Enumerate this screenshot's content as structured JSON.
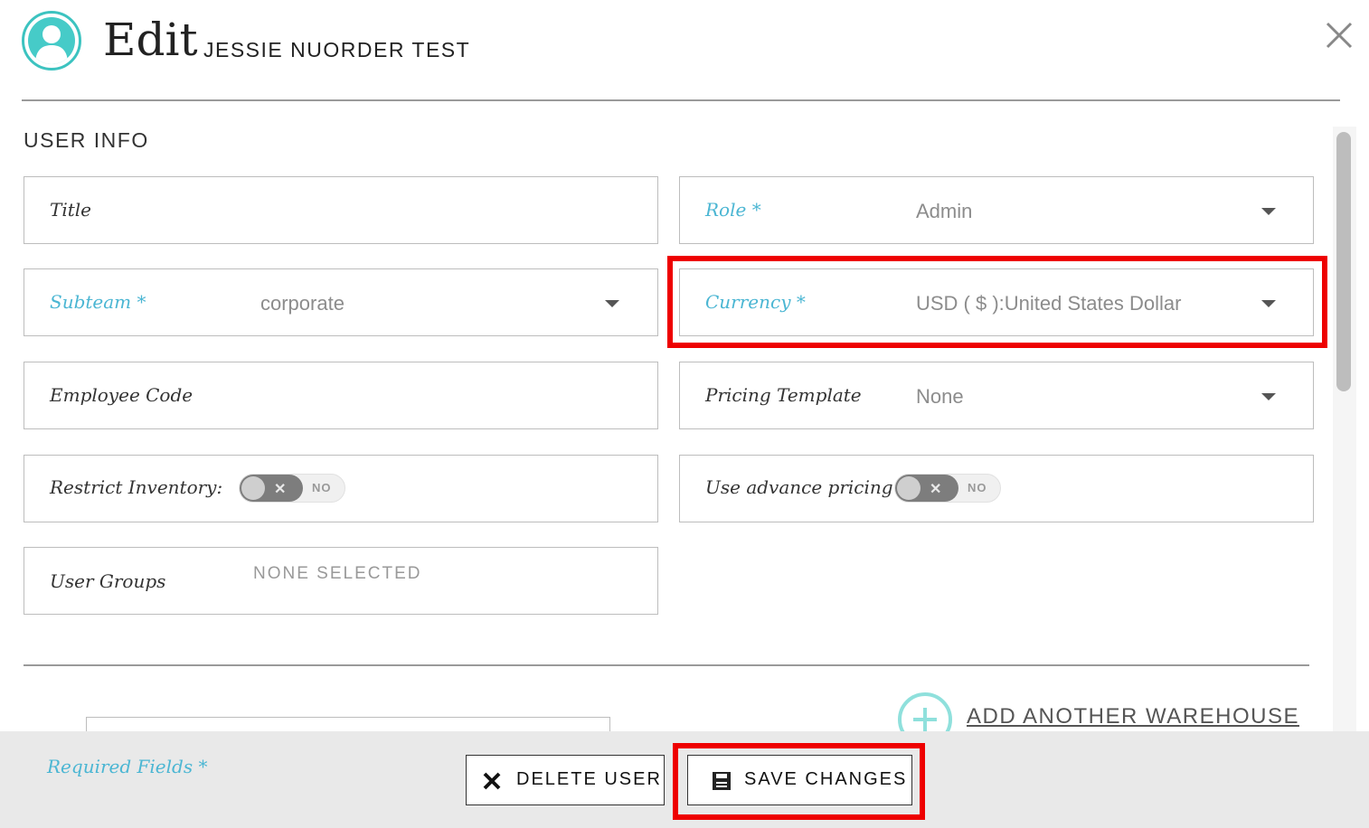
{
  "header": {
    "title": "Edit",
    "name": "JESSIE NUORDER TEST"
  },
  "section": {
    "title": "USER INFO"
  },
  "fields": {
    "title": {
      "label": "Title"
    },
    "role": {
      "label": "Role *",
      "value": "Admin"
    },
    "subteam": {
      "label": "Subteam *",
      "value": "corporate"
    },
    "currency": {
      "label": "Currency *",
      "value": "USD ( $ ):United States Dollar"
    },
    "employee_code": {
      "label": "Employee Code"
    },
    "pricing_template": {
      "label": "Pricing Template",
      "value": "None"
    },
    "restrict_inventory": {
      "label": "Restrict Inventory:",
      "toggle": "NO"
    },
    "use_advance_pricing": {
      "label": "Use advance pricing",
      "toggle": "NO"
    },
    "user_groups": {
      "label": "User Groups",
      "value": "NONE SELECTED"
    }
  },
  "warehouse": {
    "add_label": "ADD ANOTHER WAREHOUSE"
  },
  "footer": {
    "required_note": "Required Fields *",
    "delete_label": "DELETE USER",
    "save_label": "SAVE CHANGES"
  },
  "colors": {
    "accent": "#4bb6d3",
    "teal": "#3cc3c0",
    "highlight": "#ee0000"
  },
  "icons": {
    "avatar": "user-avatar-icon",
    "close": "close-icon",
    "caret": "caret-down-icon",
    "add": "plus-circle-icon",
    "delete": "x-icon",
    "save": "floppy-disk-icon"
  }
}
